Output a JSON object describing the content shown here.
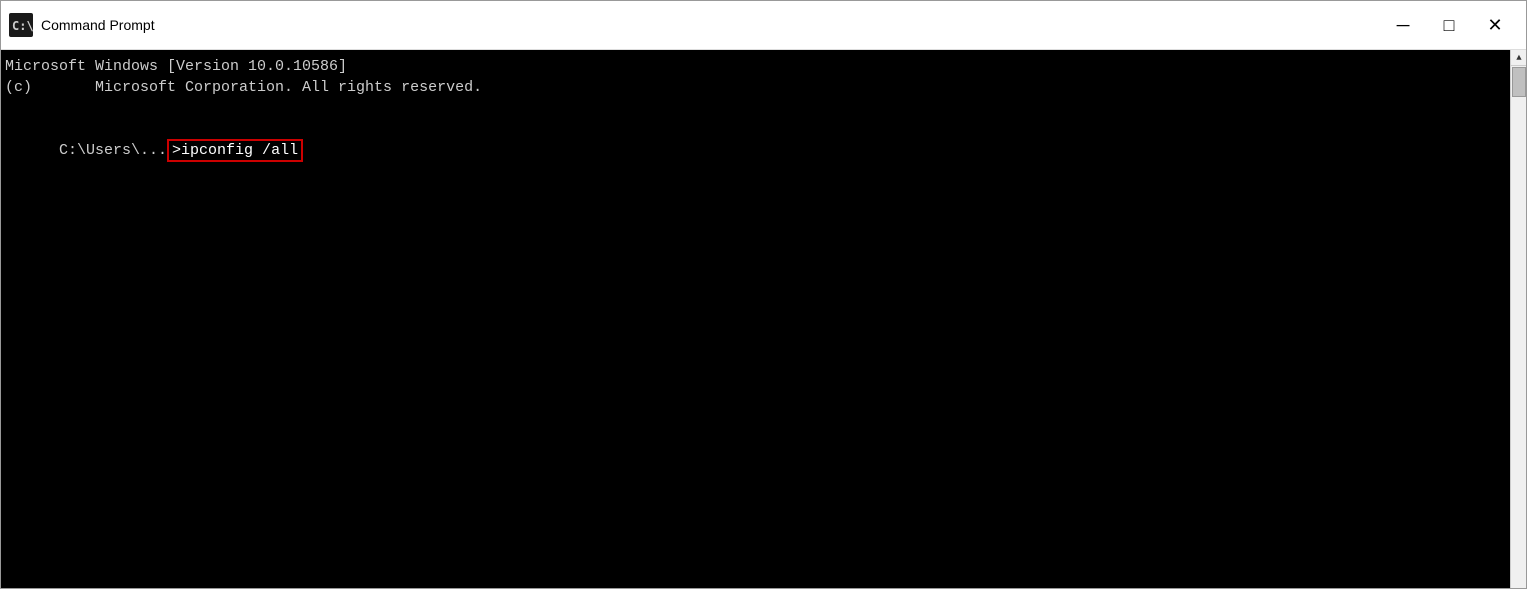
{
  "window": {
    "title": "Command Prompt",
    "icon_label": "cmd-icon"
  },
  "titlebar": {
    "minimize_label": "─",
    "maximize_label": "□",
    "close_label": "✕"
  },
  "terminal": {
    "line1": "Microsoft Windows [Version 10.0.10586]",
    "line2": "(c)       Microsoft Corporation. All rights reserved.",
    "line3": "",
    "line4_prefix": "C:\\Users\\...",
    "line4_command": ">ipconfig /all"
  }
}
